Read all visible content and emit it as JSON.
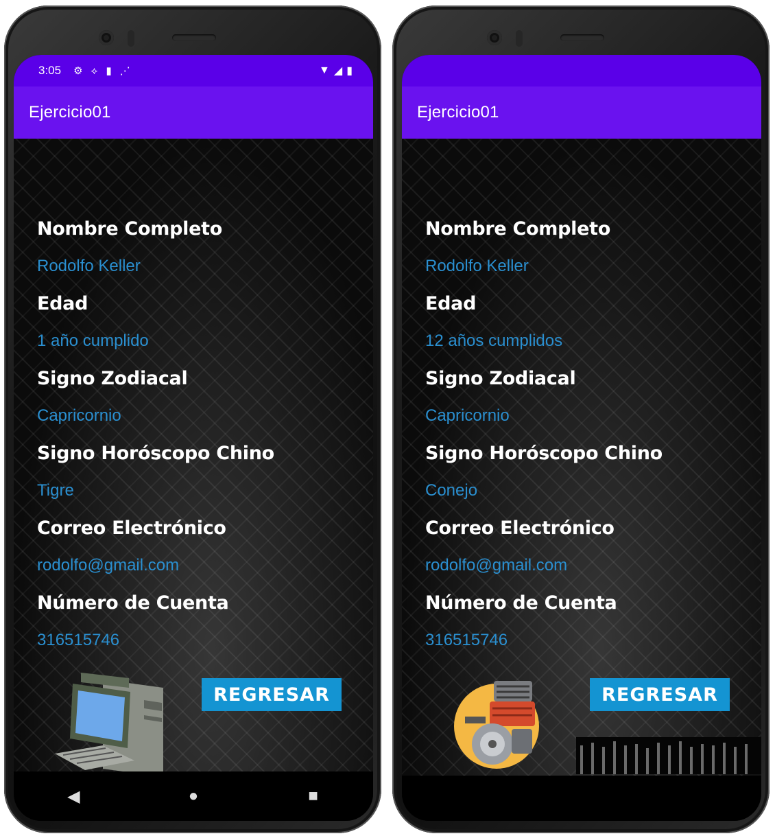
{
  "left_phone": {
    "status_bar": {
      "time": "3:05",
      "left_icons": [
        "gear-icon",
        "location-icon",
        "sd-card-icon",
        "wifi-calling-icon"
      ],
      "right_icons": [
        "wifi-icon",
        "signal-icon",
        "battery-icon"
      ]
    },
    "app_title": "Ejercicio01",
    "fields": [
      {
        "label": "Nombre Completo",
        "value": "Rodolfo Keller"
      },
      {
        "label": "Edad",
        "value": "1 año cumplido"
      },
      {
        "label": "Signo Zodiacal",
        "value": "Capricornio"
      },
      {
        "label": "Signo Horóscopo Chino",
        "value": "Tigre"
      },
      {
        "label": "Correo Electrónico",
        "value": "rodolfo@gmail.com"
      },
      {
        "label": "Número de Cuenta",
        "value": "316515746"
      }
    ],
    "button_label": "REGRESAR",
    "image": "computer-image",
    "nav": {
      "back": "◀",
      "home": "●",
      "recents": "■"
    }
  },
  "right_phone": {
    "app_title": "Ejercicio01",
    "fields": [
      {
        "label": "Nombre Completo",
        "value": "Rodolfo Keller"
      },
      {
        "label": "Edad",
        "value": "12 años cumplidos"
      },
      {
        "label": "Signo Zodiacal",
        "value": "Capricornio"
      },
      {
        "label": "Signo Horóscopo Chino",
        "value": "Conejo"
      },
      {
        "label": "Correo Electrónico",
        "value": "rodolfo@gmail.com"
      },
      {
        "label": "Número de Cuenta",
        "value": "316515746"
      }
    ],
    "button_label": "REGRESAR",
    "image": "engine-image"
  },
  "colors": {
    "status_bar": "#5a00e8",
    "app_bar": "#6a12ef",
    "label_text": "#ffffff",
    "value_text": "#2a8fd0",
    "button": "#1494d2"
  }
}
